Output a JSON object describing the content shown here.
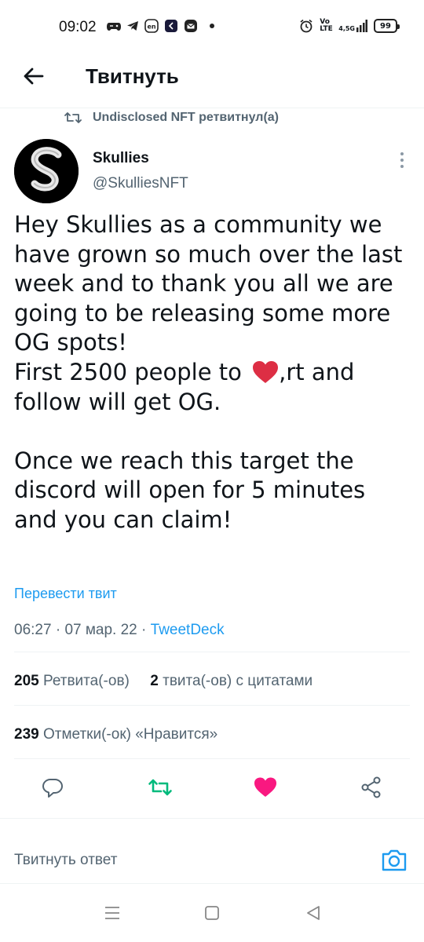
{
  "status_bar": {
    "time": "09:02",
    "network": "4,5G",
    "volte": "Vo LTE",
    "battery": "99"
  },
  "header": {
    "title": "Твитнуть"
  },
  "retweet_line": {
    "text": "Undisclosed NFT ретвитнул(а)"
  },
  "tweet": {
    "author_name": "Skullies",
    "author_handle": "@SkulliesNFT",
    "lines": [
      "Hey Skullies as a community we",
      "have grown so much over the last",
      "week and to thank you all we are",
      "going to be releasing some more",
      "OG spots!"
    ],
    "line6_before": "First 2500 people to ",
    "line6_after": ",rt and",
    "line7": "follow will get OG.",
    "line9": "Once we reach this target the",
    "line10": "discord will open for 5 minutes",
    "line11": "and you can claim!",
    "translate": "Перевести твит",
    "time": "06:27",
    "date": "07 мар. 22",
    "source": "TweetDeck"
  },
  "stats": {
    "retweets_count": "205",
    "retweets_label": "Ретвита(-ов)",
    "quotes_count": "2",
    "quotes_label": "твита(-ов) с цитатами",
    "likes_count": "239",
    "likes_label": "Отметки(-ок) «Нравится»"
  },
  "actions": {
    "retweet_color": "#00ba7c",
    "like_color": "#f91880"
  },
  "reply": {
    "placeholder": "Твитнуть ответ"
  },
  "colors": {
    "accent": "#1d9bf0",
    "text": "#0f1419",
    "secondary": "#536471"
  }
}
